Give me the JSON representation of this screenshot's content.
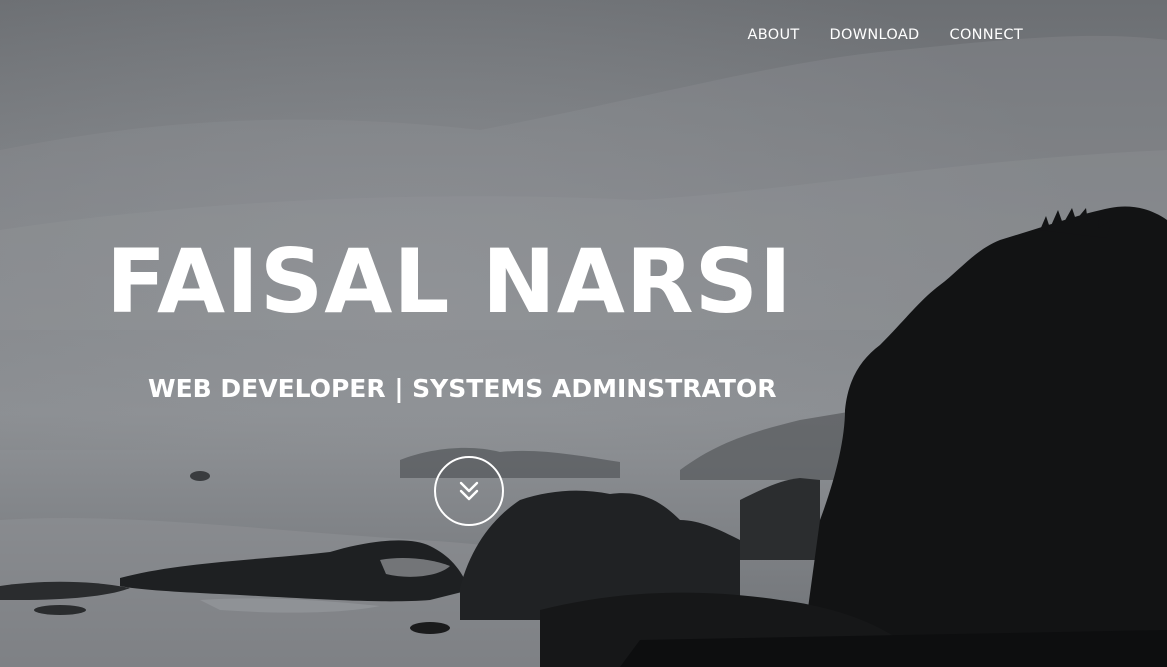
{
  "nav": {
    "links": [
      {
        "label": "ABOUT"
      },
      {
        "label": "DOWNLOAD"
      },
      {
        "label": "CONNECT"
      }
    ]
  },
  "hero": {
    "title": "FAISAL NARSI",
    "subtitle": "WEB DEVELOPER | SYSTEMS ADMINSTRATOR",
    "scroll_icon": "double-chevron-down-icon",
    "background": "misty coastal rocks photo (grayscale)"
  },
  "colors": {
    "text": "#ffffff",
    "sky": "#7d8084",
    "rocks": "#121314"
  }
}
